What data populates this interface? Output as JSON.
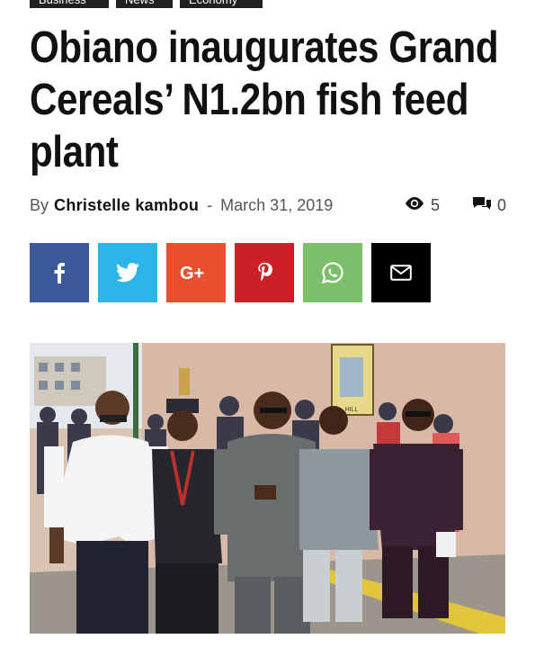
{
  "categories": [
    "Business",
    "News",
    "Economy"
  ],
  "article": {
    "title": "Obiano inaugurates Grand Cereals’ N1.2bn fish feed plant",
    "by_label": "By",
    "author": "Christelle kambou",
    "separator": "-",
    "date": "March 31, 2019",
    "views": "5",
    "comments": "0"
  },
  "share_buttons": [
    {
      "network": "facebook",
      "icon": "facebook-icon",
      "color": "#3b5998"
    },
    {
      "network": "twitter",
      "icon": "twitter-icon",
      "color": "#2cb5e8"
    },
    {
      "network": "google-plus",
      "icon": "google-plus-icon",
      "color": "#e8502f"
    },
    {
      "network": "pinterest",
      "icon": "pinterest-icon",
      "color": "#cb2027"
    },
    {
      "network": "whatsapp",
      "icon": "whatsapp-icon",
      "color": "#7bbf6a"
    },
    {
      "network": "email",
      "icon": "mail-icon",
      "color": "#000000"
    }
  ],
  "photo": {
    "poster_text": "HILL"
  }
}
